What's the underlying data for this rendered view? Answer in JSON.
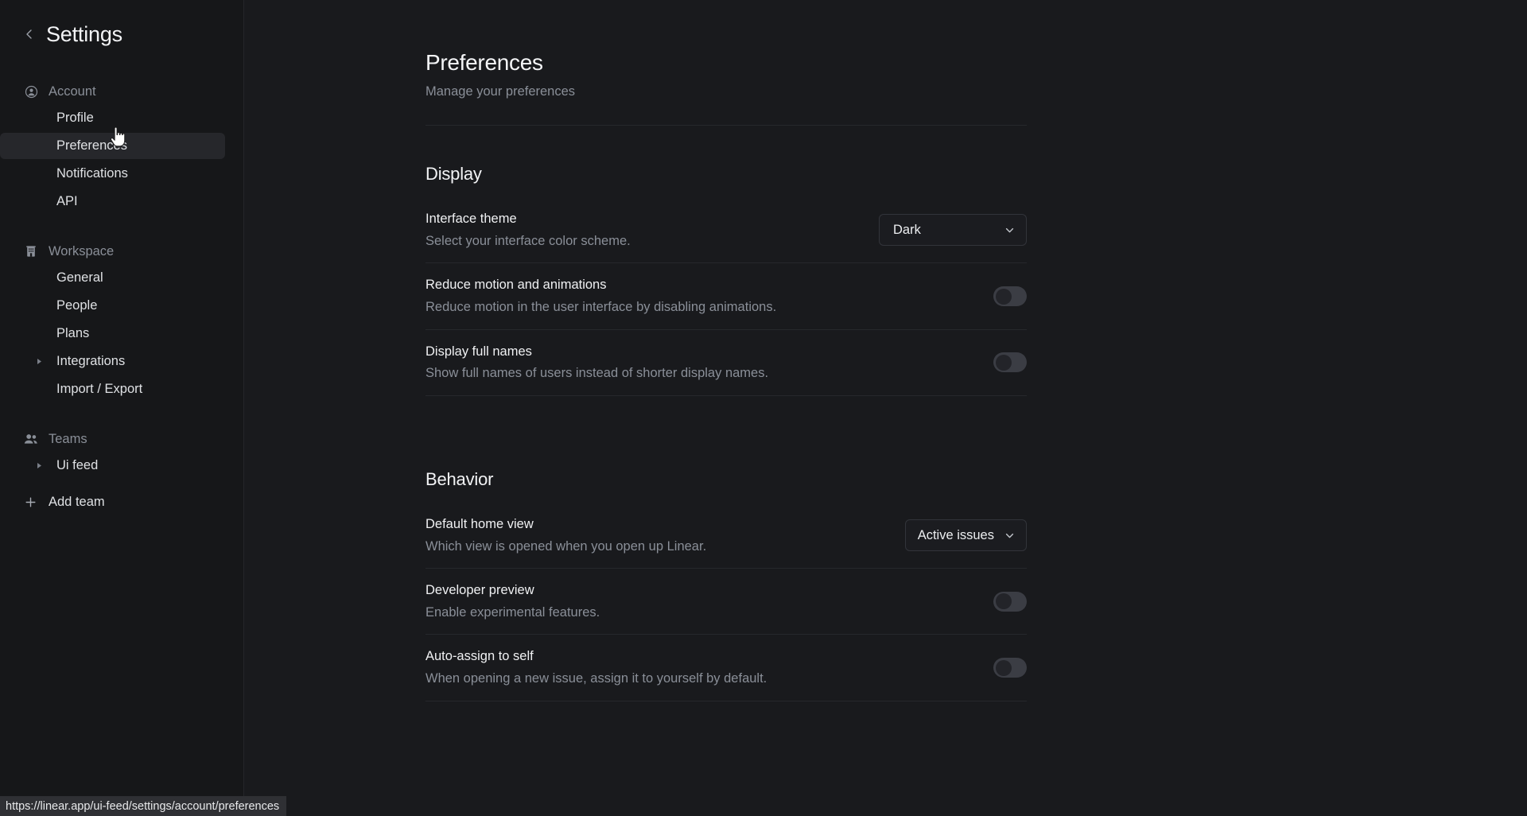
{
  "status_bar": {
    "url": "https://linear.app/ui-feed/settings/account/preferences"
  },
  "sidebar": {
    "title": "Settings",
    "back_icon": "chevron-left-icon",
    "groups": [
      {
        "label": "Account",
        "icon": "account-circle-icon",
        "items": [
          {
            "label": "Profile",
            "active": false,
            "expandable": false
          },
          {
            "label": "Preferences",
            "active": true,
            "expandable": false
          },
          {
            "label": "Notifications",
            "active": false,
            "expandable": false
          },
          {
            "label": "API",
            "active": false,
            "expandable": false
          }
        ]
      },
      {
        "label": "Workspace",
        "icon": "building-icon",
        "items": [
          {
            "label": "General",
            "active": false,
            "expandable": false
          },
          {
            "label": "People",
            "active": false,
            "expandable": false
          },
          {
            "label": "Plans",
            "active": false,
            "expandable": false
          },
          {
            "label": "Integrations",
            "active": false,
            "expandable": true
          },
          {
            "label": "Import / Export",
            "active": false,
            "expandable": false
          }
        ]
      },
      {
        "label": "Teams",
        "icon": "people-icon",
        "items": [
          {
            "label": "Ui feed",
            "active": false,
            "expandable": true
          }
        ]
      }
    ],
    "add_team": {
      "label": "Add team",
      "icon": "plus-icon"
    }
  },
  "main": {
    "title": "Preferences",
    "subtitle": "Manage your preferences",
    "sections": [
      {
        "title": "Display",
        "rows": [
          {
            "label": "Interface theme",
            "desc": "Select your interface color scheme.",
            "control": "select",
            "value": "Dark",
            "width": "wide"
          },
          {
            "label": "Reduce motion and animations",
            "desc": "Reduce motion in the user interface by disabling animations.",
            "control": "toggle",
            "value": "off"
          },
          {
            "label": "Display full names",
            "desc": "Show full names of users instead of shorter display names.",
            "control": "toggle",
            "value": "off"
          }
        ]
      },
      {
        "title": "Behavior",
        "rows": [
          {
            "label": "Default home view",
            "desc": "Which view is opened when you open up Linear.",
            "control": "select",
            "value": "Active issues",
            "width": "narrow"
          },
          {
            "label": "Developer preview",
            "desc": "Enable experimental features.",
            "control": "toggle",
            "value": "off"
          },
          {
            "label": "Auto-assign to self",
            "desc": "When opening a new issue, assign it to yourself by default.",
            "control": "toggle",
            "value": "off"
          }
        ]
      }
    ]
  },
  "colors": {
    "sidebar_bg": "#161719",
    "main_bg": "#191a1d",
    "active_item_bg": "#26272b",
    "divider": "#26282c",
    "text_primary": "#f0f1f3",
    "text_muted": "#8a8f98",
    "status_bar_bg": "#2f3034"
  }
}
